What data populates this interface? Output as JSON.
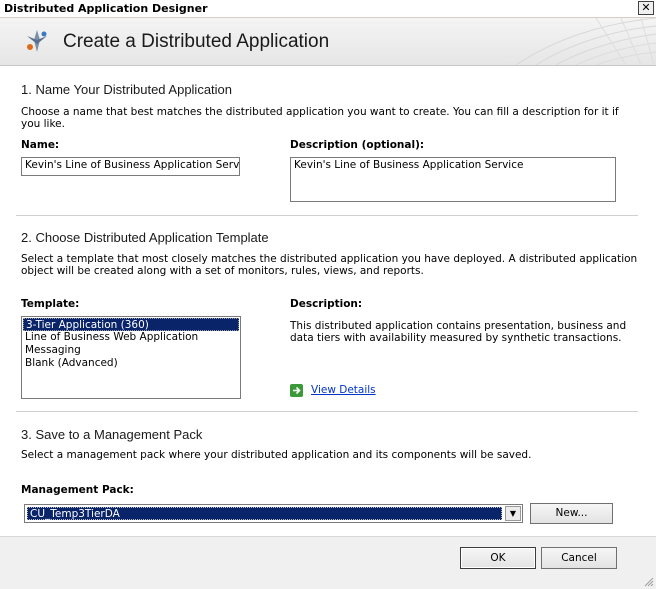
{
  "window": {
    "title": "Distributed Application Designer"
  },
  "header": {
    "title": "Create a Distributed Application"
  },
  "section1": {
    "title": "1. Name Your Distributed Application",
    "description_line1": "Choose a name that best matches the distributed application you want to create. You can fill a description for it if",
    "description_line2": "you like.",
    "name_label": "Name:",
    "name_value": "Kevin's Line of Business Application Service",
    "desc_label": "Description (optional):",
    "desc_value": "Kevin's Line of Business Application Service"
  },
  "section2": {
    "title": "2. Choose Distributed Application Template",
    "description_line1": "Select a template that most closely matches the distributed application you have deployed. A distributed application",
    "description_line2": "object will be created along with a set of monitors, rules, views, and reports.",
    "template_label": "Template:",
    "templates": [
      "3-Tier Application (360)",
      "Line of Business Web Application",
      "Messaging",
      "Blank (Advanced)"
    ],
    "selected_index": 0,
    "description_label": "Description:",
    "template_desc_line1": "This distributed application contains presentation, business and",
    "template_desc_line2": "data tiers with availability measured by synthetic transactions.",
    "view_details": "View Details"
  },
  "section3": {
    "title": "3. Save to a Management Pack",
    "description": "Select a management pack where your distributed application and its components will be saved.",
    "mp_label": "Management Pack:",
    "mp_value": "CU_Temp3TierDA",
    "new_button": "New..."
  },
  "footer": {
    "ok": "OK",
    "cancel": "Cancel"
  }
}
